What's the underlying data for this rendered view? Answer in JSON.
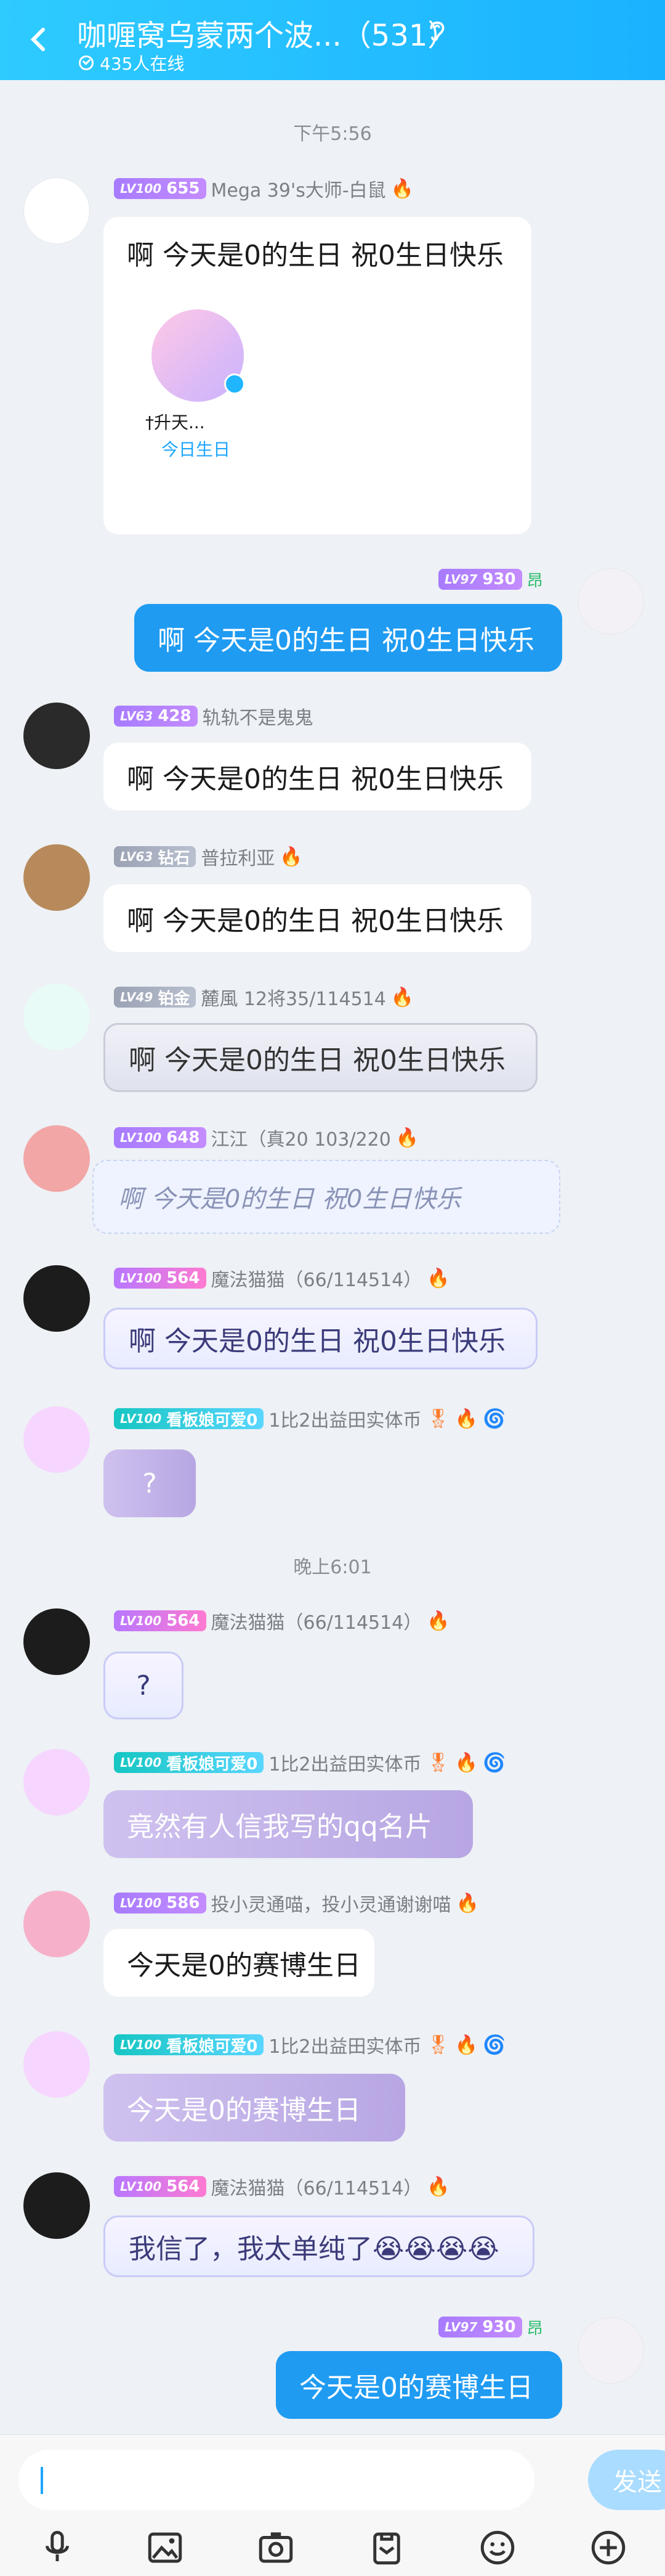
{
  "header": {
    "title": "咖喱窝乌蒙两个波...（531）",
    "online": "435人在线"
  },
  "times": [
    "下午5:56",
    "晚上6:01"
  ],
  "messages": [
    {
      "level": "LV100",
      "rank": "655",
      "name": "Mega 39's大师-白鼠",
      "text": "啊 今天是0的生日 祝0生日快乐",
      "card_name": "†升天...",
      "card_sub": "今日生日"
    },
    {
      "level": "LV97",
      "rank": "930",
      "tag": "昂",
      "text": "啊 今天是0的生日 祝0生日快乐"
    },
    {
      "level": "LV63",
      "rank": "428",
      "name": "轨轨不是鬼鬼",
      "text": "啊 今天是0的生日 祝0生日快乐"
    },
    {
      "level": "LV63",
      "rank": "钻石",
      "name": "普拉利亚",
      "text": "啊 今天是0的生日 祝0生日快乐"
    },
    {
      "level": "LV49",
      "rank": "铂金",
      "name": "麓風 12将35/114514",
      "text": "啊 今天是0的生日 祝0生日快乐"
    },
    {
      "level": "LV100",
      "rank": "648",
      "name": "江江（真20 103/220",
      "text": "啊 今天是0的生日 祝0生日快乐"
    },
    {
      "level": "LV100",
      "rank": "564",
      "name": "魔法猫猫（66/114514）",
      "text": "啊 今天是0的生日 祝0生日快乐"
    },
    {
      "level": "LV100",
      "rank": "看板娘可爱0",
      "name": "1比2出益田实体币",
      "text": "?"
    },
    {
      "level": "LV100",
      "rank": "564",
      "name": "魔法猫猫（66/114514）",
      "text": "?"
    },
    {
      "level": "LV100",
      "rank": "看板娘可爱0",
      "name": "1比2出益田实体币",
      "text": "竟然有人信我写的qq名片"
    },
    {
      "level": "LV100",
      "rank": "586",
      "name": "投小灵通喵，投小灵通谢谢喵",
      "text": "今天是0的赛博生日"
    },
    {
      "level": "LV100",
      "rank": "看板娘可爱0",
      "name": "1比2出益田实体币",
      "text": "今天是0的赛博生日"
    },
    {
      "level": "LV100",
      "rank": "564",
      "name": "魔法猫猫（66/114514）",
      "text": "我信了，我太单纯了😭😭😭😭"
    },
    {
      "level": "LV97",
      "rank": "930",
      "tag": "昂",
      "text": "今天是0的赛博生日"
    }
  ],
  "input": {
    "send": "发送"
  },
  "icons": [
    "mic-icon",
    "image-icon",
    "camera-icon",
    "clipboard-icon",
    "emoji-icon",
    "plus-icon"
  ]
}
